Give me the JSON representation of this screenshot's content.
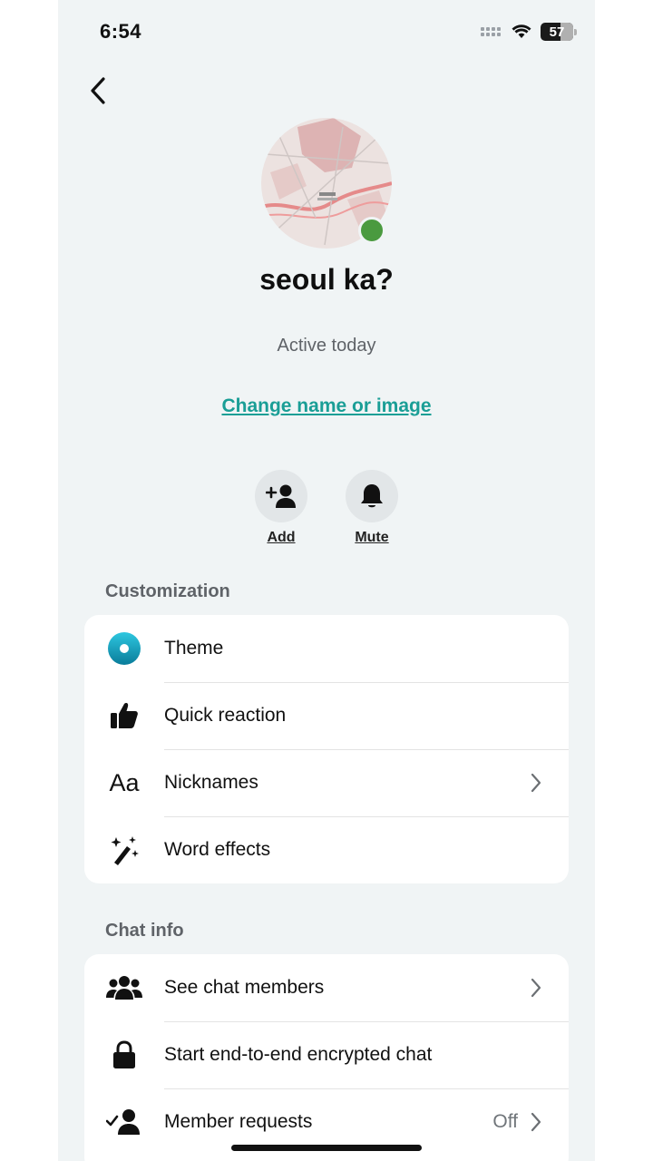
{
  "status_bar": {
    "time": "6:54",
    "battery": "57"
  },
  "profile": {
    "name": "seoul ka?",
    "status": "Active today",
    "change_link": "Change name or image"
  },
  "actions": [
    {
      "label": "Add",
      "icon": "add-person-icon"
    },
    {
      "label": "Mute",
      "icon": "bell-icon"
    }
  ],
  "customization": {
    "title": "Customization",
    "items": [
      {
        "label": "Theme",
        "icon": "theme-icon"
      },
      {
        "label": "Quick reaction",
        "icon": "thumbs-up-icon"
      },
      {
        "label": "Nicknames",
        "icon": "aa-icon",
        "icon_text": "Aa"
      },
      {
        "label": "Word effects",
        "icon": "magic-wand-icon"
      }
    ]
  },
  "chat_info": {
    "title": "Chat info",
    "items": [
      {
        "label": "See chat members",
        "icon": "people-icon"
      },
      {
        "label": "Start end-to-end encrypted chat",
        "icon": "lock-icon"
      },
      {
        "label": "Member requests",
        "icon": "person-check-icon",
        "value": "Off"
      }
    ]
  },
  "colors": {
    "accent": "#1a9e96",
    "online": "#4a9a3f",
    "background": "#f0f4f5"
  }
}
